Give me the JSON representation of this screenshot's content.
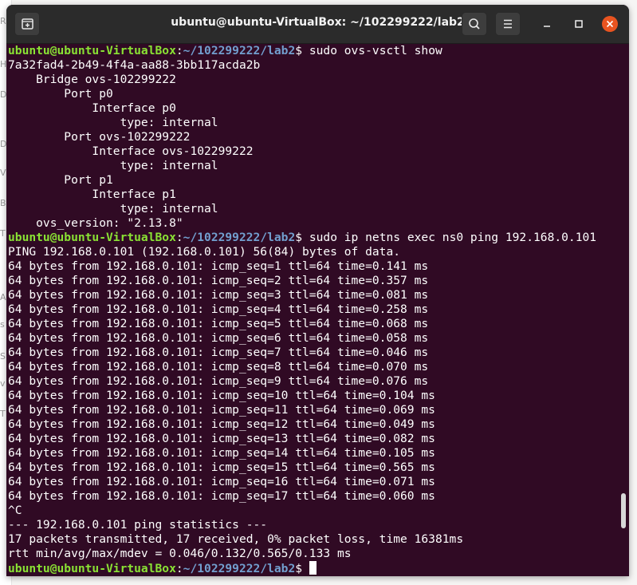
{
  "window": {
    "title": "ubuntu@ubuntu-VirtualBox: ~/102299222/lab2",
    "close_color": "#e95420"
  },
  "icons": {
    "new_tab": "new-tab-icon",
    "search": "search-icon",
    "menu": "hamburger-menu-icon",
    "minimize": "minimize-icon",
    "maximize": "maximize-icon",
    "close": "close-icon"
  },
  "prompt": {
    "user_host": "ubuntu@ubuntu-VirtualBox",
    "path": "~/102299222/lab2",
    "suffix": "$ "
  },
  "background_letters": [
    "R",
    "H",
    "D",
    "D",
    "V",
    "B",
    "T",
    "A",
    "s",
    "S",
    "v",
    "T"
  ],
  "terminal_lines": [
    {
      "type": "prompt",
      "cmd": "sudo ovs-vsctl show"
    },
    {
      "type": "out",
      "text": "7a32fad4-2b49-4f4a-aa88-3bb117acda2b"
    },
    {
      "type": "out",
      "text": "    Bridge ovs-102299222"
    },
    {
      "type": "out",
      "text": "        Port p0"
    },
    {
      "type": "out",
      "text": "            Interface p0"
    },
    {
      "type": "out",
      "text": "                type: internal"
    },
    {
      "type": "out",
      "text": "        Port ovs-102299222"
    },
    {
      "type": "out",
      "text": "            Interface ovs-102299222"
    },
    {
      "type": "out",
      "text": "                type: internal"
    },
    {
      "type": "out",
      "text": "        Port p1"
    },
    {
      "type": "out",
      "text": "            Interface p1"
    },
    {
      "type": "out",
      "text": "                type: internal"
    },
    {
      "type": "out",
      "text": "    ovs_version: \"2.13.8\""
    },
    {
      "type": "prompt",
      "cmd": "sudo ip netns exec ns0 ping 192.168.0.101"
    },
    {
      "type": "out",
      "text": "PING 192.168.0.101 (192.168.0.101) 56(84) bytes of data."
    },
    {
      "type": "out",
      "text": "64 bytes from 192.168.0.101: icmp_seq=1 ttl=64 time=0.141 ms"
    },
    {
      "type": "out",
      "text": "64 bytes from 192.168.0.101: icmp_seq=2 ttl=64 time=0.357 ms"
    },
    {
      "type": "out",
      "text": "64 bytes from 192.168.0.101: icmp_seq=3 ttl=64 time=0.081 ms"
    },
    {
      "type": "out",
      "text": "64 bytes from 192.168.0.101: icmp_seq=4 ttl=64 time=0.258 ms"
    },
    {
      "type": "out",
      "text": "64 bytes from 192.168.0.101: icmp_seq=5 ttl=64 time=0.068 ms"
    },
    {
      "type": "out",
      "text": "64 bytes from 192.168.0.101: icmp_seq=6 ttl=64 time=0.058 ms"
    },
    {
      "type": "out",
      "text": "64 bytes from 192.168.0.101: icmp_seq=7 ttl=64 time=0.046 ms"
    },
    {
      "type": "out",
      "text": "64 bytes from 192.168.0.101: icmp_seq=8 ttl=64 time=0.070 ms"
    },
    {
      "type": "out",
      "text": "64 bytes from 192.168.0.101: icmp_seq=9 ttl=64 time=0.076 ms"
    },
    {
      "type": "out",
      "text": "64 bytes from 192.168.0.101: icmp_seq=10 ttl=64 time=0.104 ms"
    },
    {
      "type": "out",
      "text": "64 bytes from 192.168.0.101: icmp_seq=11 ttl=64 time=0.069 ms"
    },
    {
      "type": "out",
      "text": "64 bytes from 192.168.0.101: icmp_seq=12 ttl=64 time=0.049 ms"
    },
    {
      "type": "out",
      "text": "64 bytes from 192.168.0.101: icmp_seq=13 ttl=64 time=0.082 ms"
    },
    {
      "type": "out",
      "text": "64 bytes from 192.168.0.101: icmp_seq=14 ttl=64 time=0.105 ms"
    },
    {
      "type": "out",
      "text": "64 bytes from 192.168.0.101: icmp_seq=15 ttl=64 time=0.565 ms"
    },
    {
      "type": "out",
      "text": "64 bytes from 192.168.0.101: icmp_seq=16 ttl=64 time=0.071 ms"
    },
    {
      "type": "out",
      "text": "64 bytes from 192.168.0.101: icmp_seq=17 ttl=64 time=0.060 ms"
    },
    {
      "type": "out",
      "text": "^C"
    },
    {
      "type": "out",
      "text": "--- 192.168.0.101 ping statistics ---"
    },
    {
      "type": "out",
      "text": "17 packets transmitted, 17 received, 0% packet loss, time 16381ms"
    },
    {
      "type": "out",
      "text": "rtt min/avg/max/mdev = 0.046/0.132/0.565/0.133 ms"
    },
    {
      "type": "prompt",
      "cmd": "",
      "cursor": true
    }
  ]
}
